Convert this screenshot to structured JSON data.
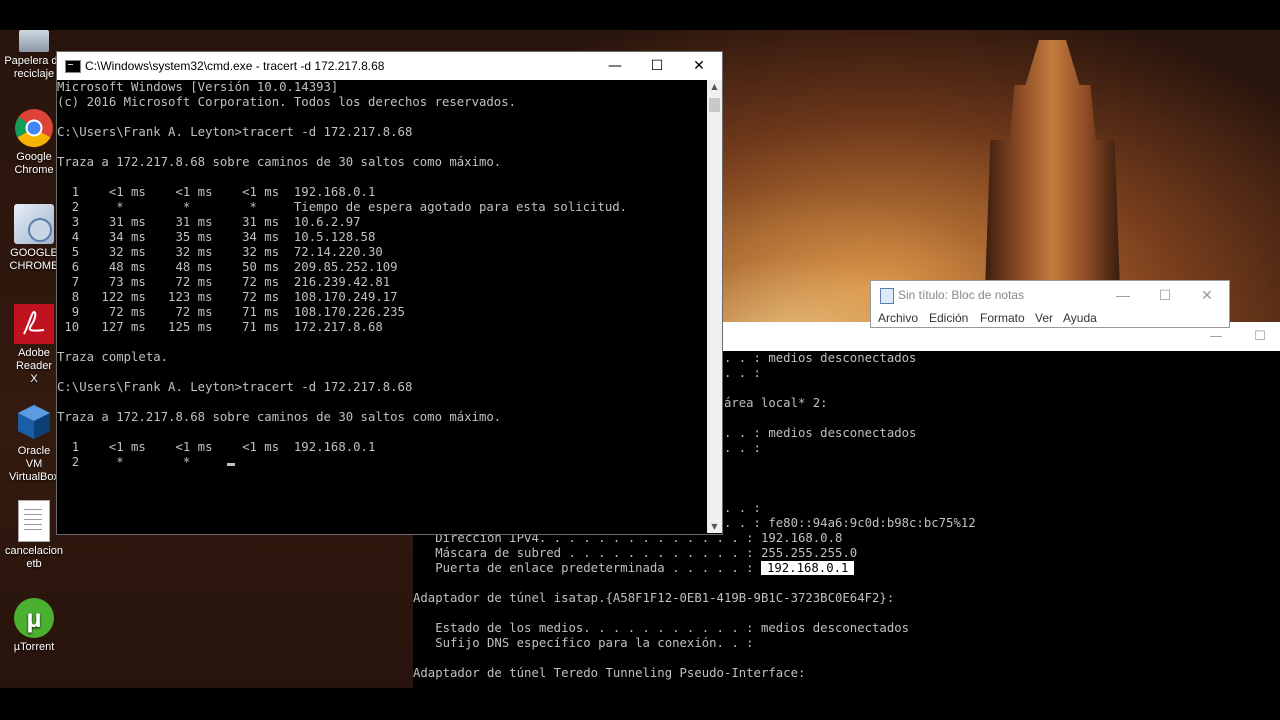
{
  "desktop_icons": [
    {
      "label": "Papelera de reciclaje",
      "icon": "recycle-bin-icon"
    },
    {
      "label": "Google Chrome",
      "icon": "chrome-icon"
    },
    {
      "label": "GOOGLE CHROME",
      "icon": "chrome-setup-icon"
    },
    {
      "label": "Adobe Reader X",
      "icon": "adobe-reader-icon"
    },
    {
      "label": "Oracle VM VirtualBox",
      "icon": "virtualbox-icon"
    },
    {
      "label": "cancelacion etb",
      "icon": "document-icon"
    },
    {
      "label": "µTorrent",
      "icon": "utorrent-icon"
    }
  ],
  "cmd_window": {
    "title": "C:\\Windows\\system32\\cmd.exe - tracert  -d 172.217.8.68",
    "controls": {
      "minimize": "—",
      "maximize": "☐",
      "close": "✕"
    },
    "lines": [
      "Microsoft Windows [Versión 10.0.14393]",
      "(c) 2016 Microsoft Corporation. Todos los derechos reservados.",
      "",
      "C:\\Users\\Frank A. Leyton>tracert -d 172.217.8.68",
      "",
      "Traza a 172.217.8.68 sobre caminos de 30 saltos como máximo.",
      "",
      "  1    <1 ms    <1 ms    <1 ms  192.168.0.1",
      "  2     *        *        *     Tiempo de espera agotado para esta solicitud.",
      "  3    31 ms    31 ms    31 ms  10.6.2.97",
      "  4    34 ms    35 ms    34 ms  10.5.128.58",
      "  5    32 ms    32 ms    32 ms  72.14.220.30",
      "  6    48 ms    48 ms    50 ms  209.85.252.109",
      "  7    73 ms    72 ms    72 ms  216.239.42.81",
      "  8   122 ms   123 ms    72 ms  108.170.249.17",
      "  9    72 ms    72 ms    71 ms  108.170.226.235",
      " 10   127 ms   125 ms    71 ms  172.217.8.68",
      "",
      "Traza completa.",
      "",
      "C:\\Users\\Frank A. Leyton>tracert -d 172.217.8.68",
      "",
      "Traza a 172.217.8.68 sobre caminos de 30 saltos como máximo.",
      "",
      "  1    <1 ms    <1 ms    <1 ms  192.168.0.1",
      "  2     *        *     "
    ]
  },
  "notepad": {
    "title": "Sin título: Bloc de notas",
    "menu": [
      "Archivo",
      "Edición",
      "Formato",
      "Ver",
      "Ayuda"
    ],
    "controls": {
      "minimize": "—",
      "maximize": "☐",
      "close": "✕"
    }
  },
  "cmd_window_2": {
    "controls": {
      "minimize": "—",
      "maximize": "☐"
    },
    "lines": [
      "                                          . . : medios desconectados",
      "                                          . . :",
      "",
      "                                          área local* 2:",
      "",
      "                                          . . : medios desconectados",
      "                                          . . :",
      "",
      "",
      "",
      "                                          . . :",
      "                                          . . : fe80::94a6:9c0d:b98c:bc75%12",
      "   Dirección IPv4. . . . . . . . . . . . . . : 192.168.0.8",
      "   Máscara de subred . . . . . . . . . . . . : 255.255.255.0",
      "   Puerta de enlace predeterminada . . . . . :",
      "",
      "Adaptador de túnel isatap.{A58F1F12-0EB1-419B-9B1C-3723BC0E64F2}:",
      "",
      "   Estado de los medios. . . . . . . . . . . : medios desconectados",
      "   Sufijo DNS específico para la conexión. . :",
      "",
      "Adaptador de túnel Teredo Tunneling Pseudo-Interface:"
    ],
    "highlighted_gateway": "192.168.0.1"
  }
}
